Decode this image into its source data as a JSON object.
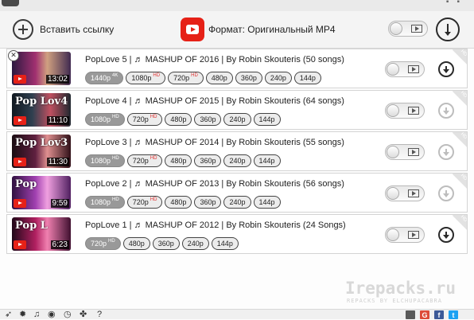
{
  "toolbar": {
    "paste_link_label": "Вставить ссылку",
    "format_label": "Формат: Оригинальный MP4"
  },
  "videos": [
    {
      "title": "PopLove 5 | ♬ MASHUP OF 2016 | By Robin Skouteris  (50 songs)",
      "duration": "13:02",
      "thumb_text": "",
      "qualities": [
        {
          "label": "1440p",
          "tag": "4K",
          "selected": true
        },
        {
          "label": "1080p",
          "tag": "HD",
          "selected": false
        },
        {
          "label": "720p",
          "tag": "HD",
          "selected": false
        },
        {
          "label": "480p",
          "tag": "",
          "selected": false
        },
        {
          "label": "360p",
          "tag": "",
          "selected": false
        },
        {
          "label": "240p",
          "tag": "",
          "selected": false
        },
        {
          "label": "144p",
          "tag": "",
          "selected": false
        }
      ],
      "download_enabled": true
    },
    {
      "title": "PopLove 4 | ♬ MASHUP OF 2015 | By Robin Skouteris  (64 songs)",
      "duration": "11:10",
      "thumb_text": "Pop Lov4",
      "qualities": [
        {
          "label": "1080p",
          "tag": "HD",
          "selected": true
        },
        {
          "label": "720p",
          "tag": "HD",
          "selected": false
        },
        {
          "label": "480p",
          "tag": "",
          "selected": false
        },
        {
          "label": "360p",
          "tag": "",
          "selected": false
        },
        {
          "label": "240p",
          "tag": "",
          "selected": false
        },
        {
          "label": "144p",
          "tag": "",
          "selected": false
        }
      ],
      "download_enabled": false
    },
    {
      "title": "PopLove 3 | ♬ MASHUP OF 2014 | By Robin Skouteris  (55 songs)",
      "duration": "11:30",
      "thumb_text": "Pop Lov3",
      "qualities": [
        {
          "label": "1080p",
          "tag": "HD",
          "selected": true
        },
        {
          "label": "720p",
          "tag": "HD",
          "selected": false
        },
        {
          "label": "480p",
          "tag": "",
          "selected": false
        },
        {
          "label": "360p",
          "tag": "",
          "selected": false
        },
        {
          "label": "240p",
          "tag": "",
          "selected": false
        },
        {
          "label": "144p",
          "tag": "",
          "selected": false
        }
      ],
      "download_enabled": false
    },
    {
      "title": "PopLove 2 | ♬ MASHUP OF 2013 | By Robin Skouteris  (56 songs)",
      "duration": "9:59",
      "thumb_text": "Pop",
      "qualities": [
        {
          "label": "1080p",
          "tag": "HD",
          "selected": true
        },
        {
          "label": "720p",
          "tag": "HD",
          "selected": false
        },
        {
          "label": "480p",
          "tag": "",
          "selected": false
        },
        {
          "label": "360p",
          "tag": "",
          "selected": false
        },
        {
          "label": "240p",
          "tag": "",
          "selected": false
        },
        {
          "label": "144p",
          "tag": "",
          "selected": false
        }
      ],
      "download_enabled": false
    },
    {
      "title": "PopLove 1 | ♬ MASHUP OF 2012 | By Robin Skouteris  (24 Songs)",
      "duration": "6:23",
      "thumb_text": "Pop L",
      "qualities": [
        {
          "label": "720p",
          "tag": "HD",
          "selected": true
        },
        {
          "label": "480p",
          "tag": "",
          "selected": false
        },
        {
          "label": "360p",
          "tag": "",
          "selected": false
        },
        {
          "label": "240p",
          "tag": "",
          "selected": false
        },
        {
          "label": "144p",
          "tag": "",
          "selected": false
        }
      ],
      "download_enabled": true
    }
  ],
  "corner_badge": "HD",
  "watermark": {
    "main": "Irepacks.ru",
    "sub": "REPACKS BY ELCHUPACABRA"
  },
  "bottombar": {
    "icons": [
      "smart-mode-icon",
      "settings-icon",
      "music-icon",
      "sound-icon",
      "history-icon",
      "tools-icon",
      "help-icon"
    ],
    "help_label": "?",
    "social": [
      {
        "name": "people-icon",
        "label": "",
        "color": "#5a5a5a"
      },
      {
        "name": "google-plus-icon",
        "label": "G",
        "color": "#dd4b39"
      },
      {
        "name": "facebook-icon",
        "label": "f",
        "color": "#3b5998"
      },
      {
        "name": "twitter-icon",
        "label": "t",
        "color": "#1da1f2"
      }
    ]
  },
  "colors": {
    "youtube_red": "#e62117",
    "hd_tag": "#e03030",
    "selected_pill": "#999999"
  }
}
